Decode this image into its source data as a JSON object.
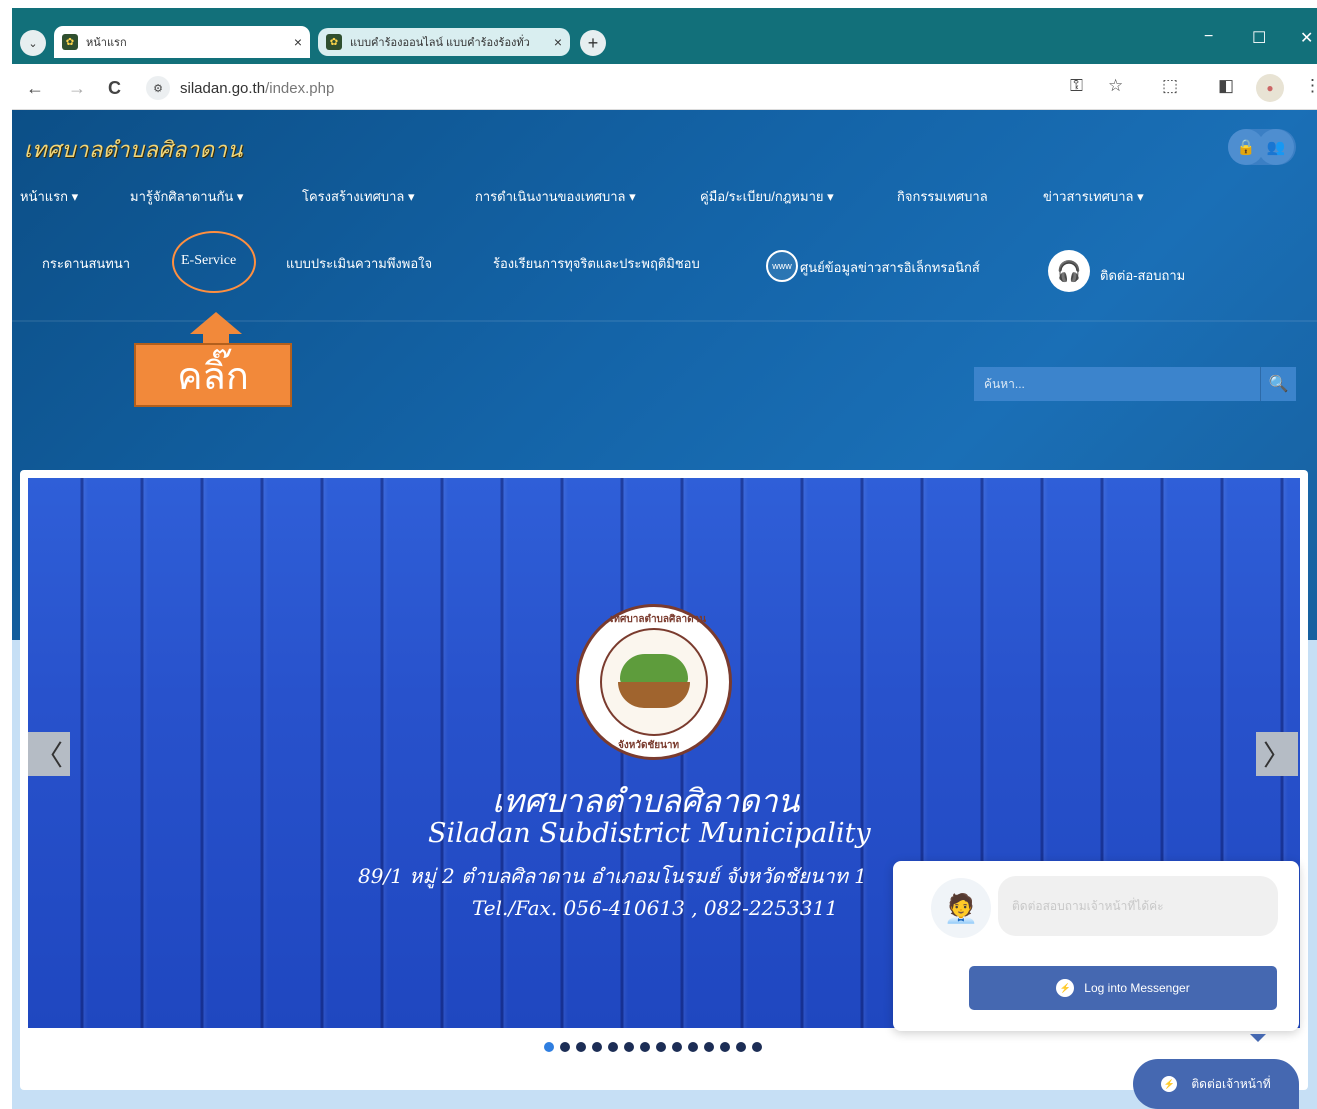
{
  "browser": {
    "tabs": [
      {
        "title": "หน้าแรก",
        "active": true
      },
      {
        "title": "แบบคำร้องออนไลน์ แบบคำร้องร้องทั่ว",
        "active": false
      }
    ],
    "new_tab": "+",
    "tab_close": "×",
    "url_host": "siladan.go.th",
    "url_path": "/index.php",
    "icons": {
      "back": "←",
      "forward": "→",
      "reload": "C",
      "minimize": "−",
      "maximize": "☐",
      "close": "✕",
      "key": "⚿",
      "star": "☆",
      "extensions": "⬚",
      "sidepanel": "◧",
      "menu": "⋮"
    }
  },
  "site": {
    "logo_text": "เทศบาลตำบลศิลาดาน",
    "menu_row1": [
      "หน้าแรก ▾",
      "มารู้จักศิลาดานกัน ▾",
      "โครงสร้างเทศบาล ▾",
      "การดำเนินงานของเทศบาล ▾",
      "คู่มือ/ระเบียบ/กฎหมาย ▾",
      "กิจกรรมเทศบาล",
      "ข่าวสารเทศบาล ▾"
    ],
    "menu_row2": [
      "กระดานสนทนา",
      "E-Service",
      "แบบประเมินความพึงพอใจ",
      "ร้องเรียนการทุจริตและประพฤติมิชอบ",
      "ศูนย์ข้อมูลข่าวสารอิเล็กทรอนิกส์",
      "ติดต่อ-สอบถาม"
    ],
    "globe_icon_label": "www",
    "search_placeholder": "ค้นหา...",
    "annotation": "คลิ๊ก"
  },
  "slider": {
    "seal_top_text": "เทศบาลตำบลศิลาดาน",
    "seal_bottom_text": "จังหวัดชัยนาท",
    "title_th": "เทศบาลตำบลศิลาดาน",
    "title_en": "Siladan Subdistrict Municipality",
    "address": "89/1 หมู่ 2 ตำบลศิลาดาน อำเภอมโนรมย์ จังหวัดชัยนาท 1",
    "phone": "Tel./Fax. 056-410613 , 082-2253311",
    "prev": "〈",
    "next": "〉",
    "dot_count": 14,
    "active_dot": 0
  },
  "messenger": {
    "greeting": "ติดต่อสอบถามเจ้าหน้าที่ได้ค่ะ",
    "login_label": "Log into Messenger",
    "contact_label": "ติดต่อเจ้าหน้าที่"
  }
}
